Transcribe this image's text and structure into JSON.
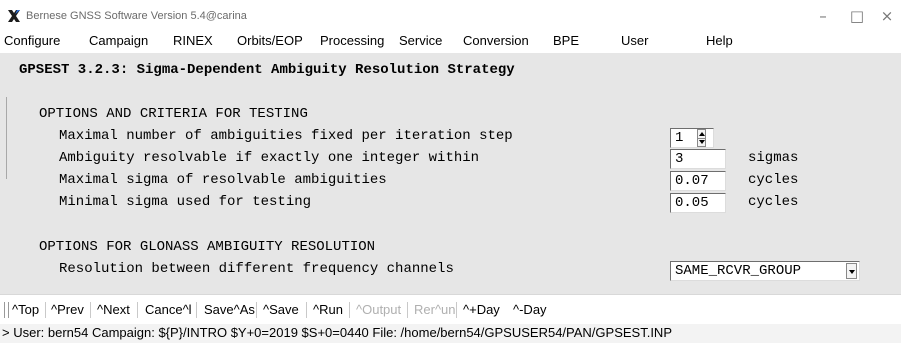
{
  "window": {
    "title": "Bernese GNSS Software Version 5.4@carina",
    "minimize": "–",
    "maximize": "□",
    "close": "×"
  },
  "menu": [
    "Configure",
    "Campaign",
    "RINEX",
    "Orbits/EOP",
    "Processing",
    "Service",
    "Conversion",
    "BPE",
    "User",
    "Help"
  ],
  "panel": {
    "heading": "GPSEST 3.2.3: Sigma-Dependent Ambiguity Resolution Strategy",
    "section1": "OPTIONS AND CRITERIA FOR TESTING",
    "options": [
      {
        "label": "Maximal number of ambiguities fixed per iteration step",
        "value": "1",
        "unit": ""
      },
      {
        "label": "Ambiguity resolvable if exactly one integer within",
        "value": "3",
        "unit": "sigmas"
      },
      {
        "label": "Maximal sigma of resolvable ambiguities",
        "value": "0.07",
        "unit": "cycles"
      },
      {
        "label": "Minimal sigma used for testing",
        "value": "0.05",
        "unit": "cycles"
      }
    ],
    "section2": "OPTIONS FOR GLONASS AMBIGUITY RESOLUTION",
    "glonass": {
      "label": "Resolution between different frequency channels",
      "value": "SAME_RCVR_GROUP"
    }
  },
  "toolbar": {
    "top": "^Top",
    "prev": "^Prev",
    "next": "^Next",
    "cancel": "Cance^l",
    "save_as": "Save^As",
    "save": "^Save",
    "run": "^Run",
    "output": "^Output",
    "rerun": "Rer^un",
    "plus_day": "^+Day",
    "minus_day": "^-Day"
  },
  "status": "> User: bern54  Campaign: ${P}/INTRO  $Y+0=2019  $S+0=0440  File: /home/bern54/GPSUSER54/PAN/GPSEST.INP"
}
